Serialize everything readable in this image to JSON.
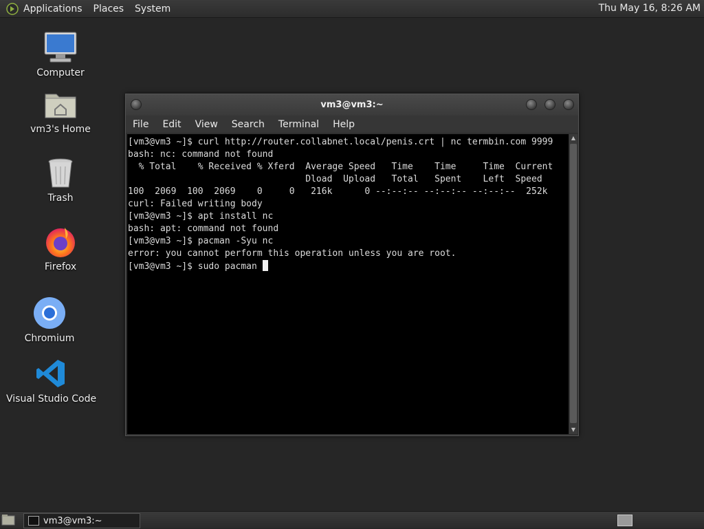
{
  "top_panel": {
    "menus": [
      "Applications",
      "Places",
      "System"
    ],
    "clock": "Thu May 16,  8:26 AM"
  },
  "desktop_icons": [
    {
      "label": "Computer",
      "icon": "computer-icon"
    },
    {
      "label": "vm3's Home",
      "icon": "home-folder-icon"
    },
    {
      "label": "Trash",
      "icon": "trash-icon"
    },
    {
      "label": "Firefox",
      "icon": "firefox-icon"
    },
    {
      "label": "Chromium",
      "icon": "chromium-icon"
    },
    {
      "label": "Visual Studio Code",
      "icon": "vscode-icon"
    }
  ],
  "terminal": {
    "title": "vm3@vm3:~",
    "menu": [
      "File",
      "Edit",
      "View",
      "Search",
      "Terminal",
      "Help"
    ],
    "lines": [
      "[vm3@vm3 ~]$ curl http://router.collabnet.local/penis.crt | nc termbin.com 9999",
      "bash: nc: command not found",
      "  % Total    % Received % Xferd  Average Speed   Time    Time     Time  Current",
      "                                 Dload  Upload   Total   Spent    Left  Speed",
      "100  2069  100  2069    0     0   216k      0 --:--:-- --:--:-- --:--:--  252k",
      "curl: Failed writing body",
      "[vm3@vm3 ~]$ apt install nc",
      "bash: apt: command not found",
      "[vm3@vm3 ~]$ pacman -Syu nc",
      "error: you cannot perform this operation unless you are root.",
      "[vm3@vm3 ~]$ sudo pacman "
    ]
  },
  "taskbar": {
    "window_label": "vm3@vm3:~"
  }
}
